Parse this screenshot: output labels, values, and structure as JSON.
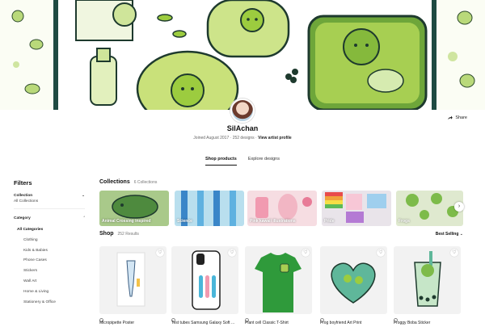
{
  "artist": {
    "name": "SilAchan",
    "joined": "Joined August 2017",
    "designs": "252 designs",
    "view_profile": "View artist profile",
    "share": "Share"
  },
  "tabs": [
    {
      "label": "Shop products",
      "active": true
    },
    {
      "label": "Explore designs",
      "active": false
    }
  ],
  "filters": {
    "title": "Filters",
    "collection_label": "Collection",
    "collection_value": "All Collections",
    "category_label": "Category",
    "categories": [
      "All Categories",
      "Clothing",
      "Kids & Babies",
      "Phone Cases",
      "Stickers",
      "Wall Art",
      "Home & Living",
      "Stationery & Office"
    ]
  },
  "collections": {
    "title": "Collections",
    "count": "6 Collections",
    "items": [
      {
        "label": "Animal Crossing inspired",
        "color": "#a9c98a"
      },
      {
        "label": "Science",
        "color": "#b9dfee"
      },
      {
        "label": "Pink kawaii illustrations",
        "color": "#f6dde2"
      },
      {
        "label": "Pride",
        "color": "#e9e4ea"
      },
      {
        "label": "Frogs",
        "color": "#dfe9cf"
      }
    ]
  },
  "shop": {
    "title": "Shop",
    "count": "252 Results",
    "sort": "Best Selling"
  },
  "products": [
    {
      "title": "Micropipette Poster"
    },
    {
      "title": "Test tubes Samsung Galaxy Soft ..."
    },
    {
      "title": "Plant cell Classic T-Shirt"
    },
    {
      "title": "Frog boyfriend Art Print"
    },
    {
      "title": "Froggy Boba Sticker"
    }
  ],
  "colors": {
    "banner_dark": "#1e4a42",
    "cell_green": "#9ccc3f",
    "shirt_green": "#2f9a3b"
  }
}
